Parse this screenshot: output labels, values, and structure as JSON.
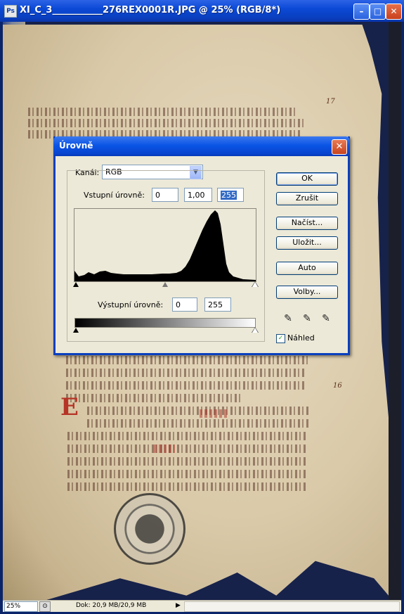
{
  "window": {
    "title": "XI_C_3___________276REX0001R.JPG @ 25% (RGB/8*)",
    "icon": "photoshop-document-icon",
    "minimize_glyph": "–",
    "maximize_glyph": "□",
    "close_glyph": "✕"
  },
  "status": {
    "zoom": "25%",
    "doc": "Dok: 20,9 MB/20,9 MB",
    "arrow": "▶"
  },
  "dialog": {
    "title": "Úrovně",
    "close_glyph": "✕",
    "channel_label": "Kanál:",
    "channel_value": "RGB",
    "input_label": "Vstupní úrovně:",
    "input_values": [
      "0",
      "1,00",
      "255"
    ],
    "output_label": "Výstupní úrovně:",
    "output_values": [
      "0",
      "255"
    ],
    "buttons": {
      "ok": "OK",
      "cancel": "Zrušit",
      "load": "Načíst...",
      "save": "Uložit...",
      "auto": "Auto",
      "options": "Volby..."
    },
    "preview_label": "Náhled",
    "preview_checked": true,
    "eyedroppers": [
      "black-eyedropper-icon",
      "gray-eyedropper-icon",
      "white-eyedropper-icon"
    ]
  },
  "manuscript": {
    "margin_notes": [
      "17",
      "16"
    ]
  }
}
